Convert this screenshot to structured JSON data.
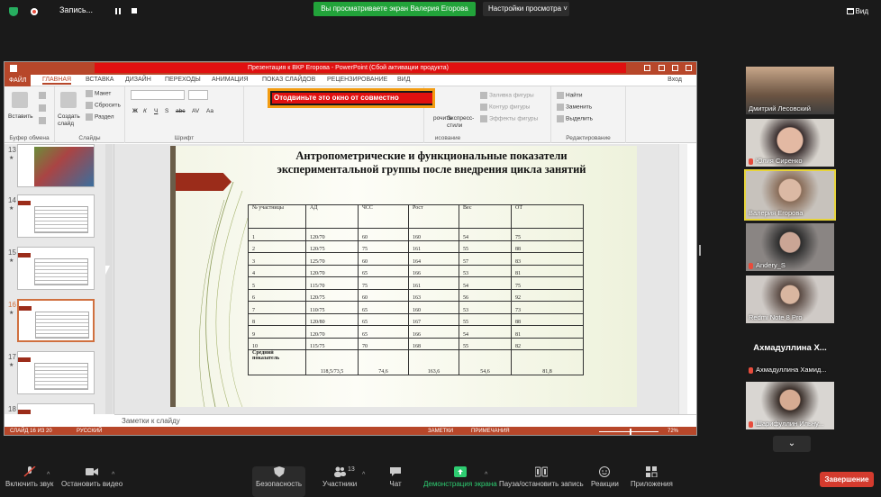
{
  "topbar": {
    "recording_label": "Запись...",
    "sharing_banner": "Вы просматриваете экран Валерия Егорова",
    "view_options": "Настройки просмотра",
    "view_label": "Вид"
  },
  "ppt": {
    "title": "Презентация к ВКР Егорова - PowerPoint (Сбой активации продукта)",
    "menu_tabs": [
      "ФАЙЛ",
      "ГЛАВНАЯ",
      "ВСТАВКА",
      "ДИЗАЙН",
      "ПЕРЕХОДЫ",
      "АНИМАЦИЯ",
      "ПОКАЗ СЛАЙДОВ",
      "РЕЦЕНЗИРОВАНИЕ",
      "ВИД"
    ],
    "login": "Вход",
    "ribbon": {
      "paste": "Вставить",
      "create_slide": "Создать слайд",
      "layout": "Макет",
      "reset": "Сбросить",
      "section": "Раздел",
      "buffer_group": "Буфер обмена",
      "slides_group": "Слайды",
      "font_group": "Шрифт",
      "draw_suffix": "исование",
      "edit_group": "Редактирование",
      "fill": "Заливка фигуры",
      "outline": "Контур фигуры",
      "effects": "Эффекты фигуры",
      "express_styles": "Экспресс-стили",
      "order_partial": "рочить",
      "find": "Найти",
      "replace": "Заменить",
      "select": "Выделить",
      "format_btns": [
        "Ж",
        "К",
        "Ч",
        "S",
        "abc",
        "AV",
        "Aa"
      ]
    },
    "warning": "Отодвиньте это окно от совместно",
    "thumbnails": [
      {
        "num": "13",
        "kind": "photo"
      },
      {
        "num": "14",
        "kind": "table"
      },
      {
        "num": "15",
        "kind": "table"
      },
      {
        "num": "16",
        "kind": "table",
        "selected": true
      },
      {
        "num": "17",
        "kind": "table"
      },
      {
        "num": "18",
        "kind": "table"
      }
    ],
    "slide": {
      "title": "Антропометрические и функциональные показатели экспериментальной группы после внедрения цикла занятий",
      "headers": [
        "№ участницы",
        "АД",
        "ЧСС",
        "Рост",
        "Вес",
        "ОТ"
      ],
      "rows": [
        [
          "1",
          "120/70",
          "60",
          "160",
          "54",
          "75"
        ],
        [
          "2",
          "120/75",
          "75",
          "161",
          "55",
          "88"
        ],
        [
          "3",
          "125/70",
          "60",
          "164",
          "57",
          "83"
        ],
        [
          "4",
          "120/70",
          "65",
          "166",
          "53",
          "81"
        ],
        [
          "5",
          "115/70",
          "75",
          "161",
          "54",
          "75"
        ],
        [
          "6",
          "120/75",
          "60",
          "163",
          "56",
          "92"
        ],
        [
          "7",
          "110/75",
          "65",
          "160",
          "53",
          "73"
        ],
        [
          "8",
          "120/80",
          "65",
          "167",
          "55",
          "88"
        ],
        [
          "9",
          "120/70",
          "65",
          "166",
          "54",
          "81"
        ],
        [
          "10",
          "115/75",
          "70",
          "168",
          "55",
          "82"
        ]
      ],
      "avg_label": "Средний показатель",
      "avg_values": [
        "118,5/73,5",
        "74,6",
        "163,6",
        "54,6",
        "81,8"
      ]
    },
    "notes_placeholder": "Заметки к слайду",
    "status": {
      "slide_info": "СЛАЙД 16 ИЗ 20",
      "language": "РУССКИЙ",
      "notes": "ЗАМЕТКИ",
      "comments": "ПРИМЕЧАНИЯ",
      "zoom": "72%",
      "zoom_fraction": 0.52
    }
  },
  "participants": [
    {
      "name": "Дмитрий Лесовский",
      "muted": false,
      "video": true
    },
    {
      "name": "Юлия Сиренко",
      "muted": true,
      "video": true
    },
    {
      "name": "Валерия Егорова",
      "muted": false,
      "video": true,
      "speaking": true
    },
    {
      "name": "Andery_S",
      "muted": true,
      "video": true
    },
    {
      "name": "Redmi Note 8 Pro",
      "muted": false,
      "video": true
    },
    {
      "name": "Ахмадуллина Хамид...",
      "muted": true,
      "video": false,
      "display": "Ахмадуллина  Х..."
    },
    {
      "name": "Шарифуллин Ильну...",
      "muted": true,
      "video": true
    }
  ],
  "toolbar": {
    "unmute": "Включить звук",
    "stop_video": "Остановить видео",
    "security": "Безопасность",
    "participants": "Участники",
    "participants_count": "13",
    "chat": "Чат",
    "share_screen": "Демонстрация экрана",
    "pause_recording": "Пауза/остановить запись",
    "reactions": "Реакции",
    "apps": "Приложения",
    "end": "Завершение"
  }
}
